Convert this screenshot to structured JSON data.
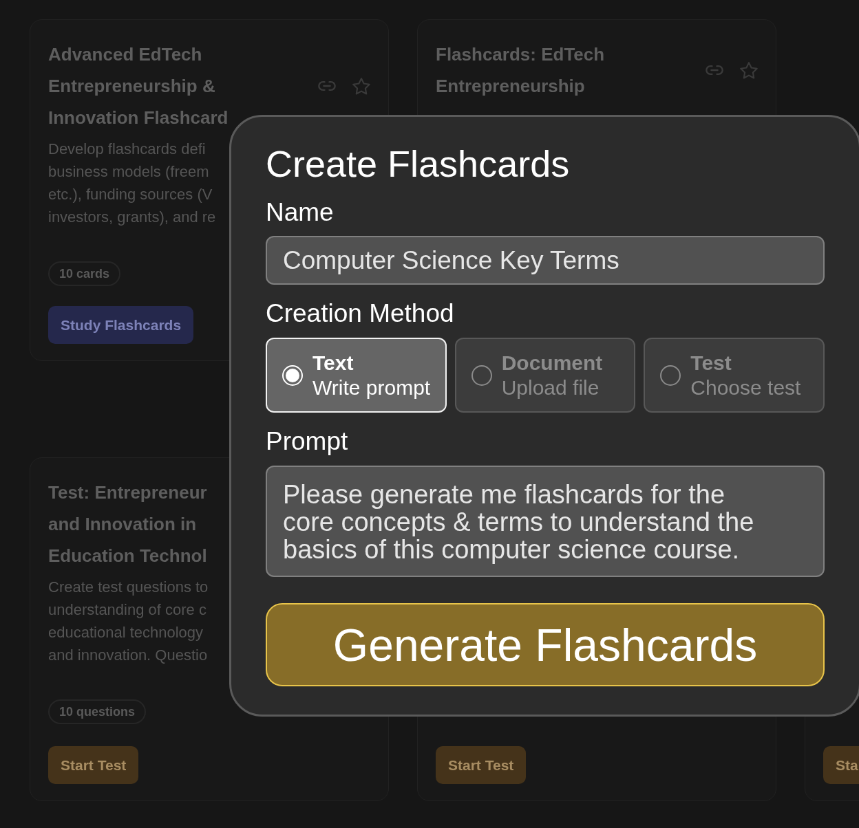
{
  "background": {
    "rows": [
      [
        {
          "kind": "flashcards",
          "title": "Advanced EdTech\nEntrepreneurship &\nInnovation Flashcard",
          "starred": false,
          "description": "Develop flashcards defi\nbusiness models (freem\netc.), funding sources (V\ninvestors, grants), and re",
          "count": "10 cards",
          "action": "Study Flashcards"
        },
        {
          "title": "Flashcards: EdTech\nEntrepreneurship",
          "starred": false
        }
      ],
      [
        {
          "kind": "test",
          "title": "Test: Entrepreneur\nand Innovation in\nEducation Technol",
          "description": "Create test questions to\nunderstanding of core c\neducational technology\nand innovation. Questio",
          "count": "10 questions",
          "action": "Start Test"
        },
        {
          "kind": "test",
          "action": "Start Test"
        },
        {
          "kind": "test",
          "action": "Sta"
        }
      ]
    ]
  },
  "dialog": {
    "title": "Create Flashcards",
    "name_label": "Name",
    "name_value": "Computer Science Key Terms",
    "method_label": "Creation Method",
    "methods": [
      {
        "title": "Text",
        "subtitle": "Write prompt",
        "selected": true
      },
      {
        "title": "Document",
        "subtitle": "Upload file",
        "selected": false
      },
      {
        "title": "Test",
        "subtitle": "Choose test",
        "selected": false
      }
    ],
    "prompt_label": "Prompt",
    "prompt_value": "Please generate me flashcards for the core concepts & terms to understand the basics of this computer science course.",
    "submit": "Generate Flashcards"
  }
}
